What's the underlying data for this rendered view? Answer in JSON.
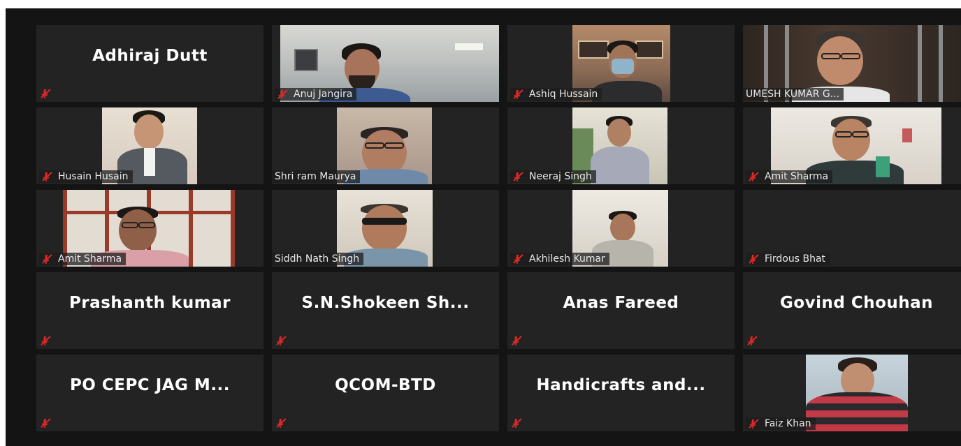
{
  "participants": [
    {
      "name": "Adhiraj Dutt",
      "video": false
    },
    {
      "name": "Anuj Jangira",
      "video": true
    },
    {
      "name": "Ashiq Hussain",
      "video": true
    },
    {
      "name": "UMESH KUMAR G...",
      "video": true
    },
    {
      "name": "Husain Husain",
      "video": true
    },
    {
      "name": "Shri ram Maurya",
      "video": true
    },
    {
      "name": "Neeraj Singh",
      "video": true
    },
    {
      "name": "Amit Sharma",
      "video": true
    },
    {
      "name": "Amit Sharma",
      "video": true
    },
    {
      "name": "Siddh Nath Singh",
      "video": true
    },
    {
      "name": "Akhilesh Kumar",
      "video": true
    },
    {
      "name": "Firdous Bhat",
      "video": false
    },
    {
      "name": "Prashanth kumar",
      "video": false
    },
    {
      "name": "S.N.Shokeen  Sh...",
      "video": false
    },
    {
      "name": "Anas Fareed",
      "video": false
    },
    {
      "name": "Govind Chouhan",
      "video": false
    },
    {
      "name": "PO CEPC JAG M...",
      "video": false
    },
    {
      "name": "QCOM-BTD",
      "video": false
    },
    {
      "name": "Handicrafts  and...",
      "video": false
    },
    {
      "name": "Faiz Khan",
      "video": true
    }
  ],
  "icons": {
    "muted": "microphone-muted-icon"
  },
  "colors": {
    "background": "#141414",
    "tile": "#232323",
    "mute": "#e02828"
  }
}
